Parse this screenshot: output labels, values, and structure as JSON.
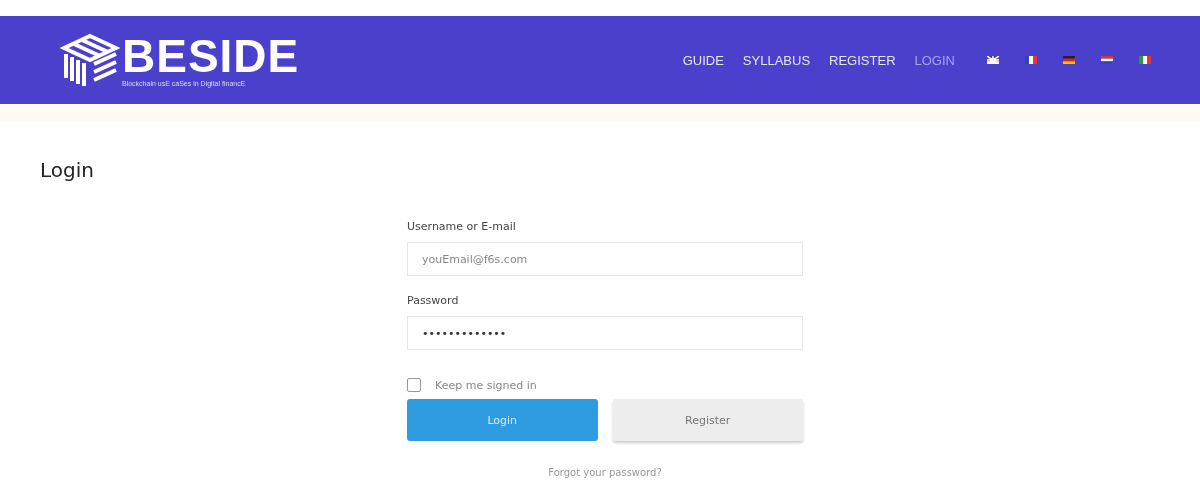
{
  "header": {
    "logo": {
      "title": "BESIDE",
      "tagline": "Blockchain usE caSes in Digital financE"
    },
    "nav": [
      {
        "label": "GUIDE",
        "selected": false
      },
      {
        "label": "SYLLABUS",
        "selected": false
      },
      {
        "label": "REGISTER",
        "selected": false
      },
      {
        "label": "LOGIN",
        "selected": true
      }
    ],
    "languages": [
      {
        "kind": "uk"
      },
      {
        "kind": "fr"
      },
      {
        "kind": "de"
      },
      {
        "kind": "nl"
      },
      {
        "kind": "it"
      }
    ]
  },
  "page_title": "Login",
  "form": {
    "fields": [
      {
        "label": "Username or E-mail",
        "placeholder": "youEmail@f6s.com"
      },
      {
        "label": "Password",
        "value": "•••••••••••••"
      }
    ],
    "remember": {
      "label": "Keep me signed in",
      "checked": false
    },
    "buttons": [
      {
        "label": "Login",
        "kind": "primary"
      },
      {
        "label": "Register",
        "kind": "secondary"
      }
    ],
    "forgot_link": "Forgot your password?"
  }
}
